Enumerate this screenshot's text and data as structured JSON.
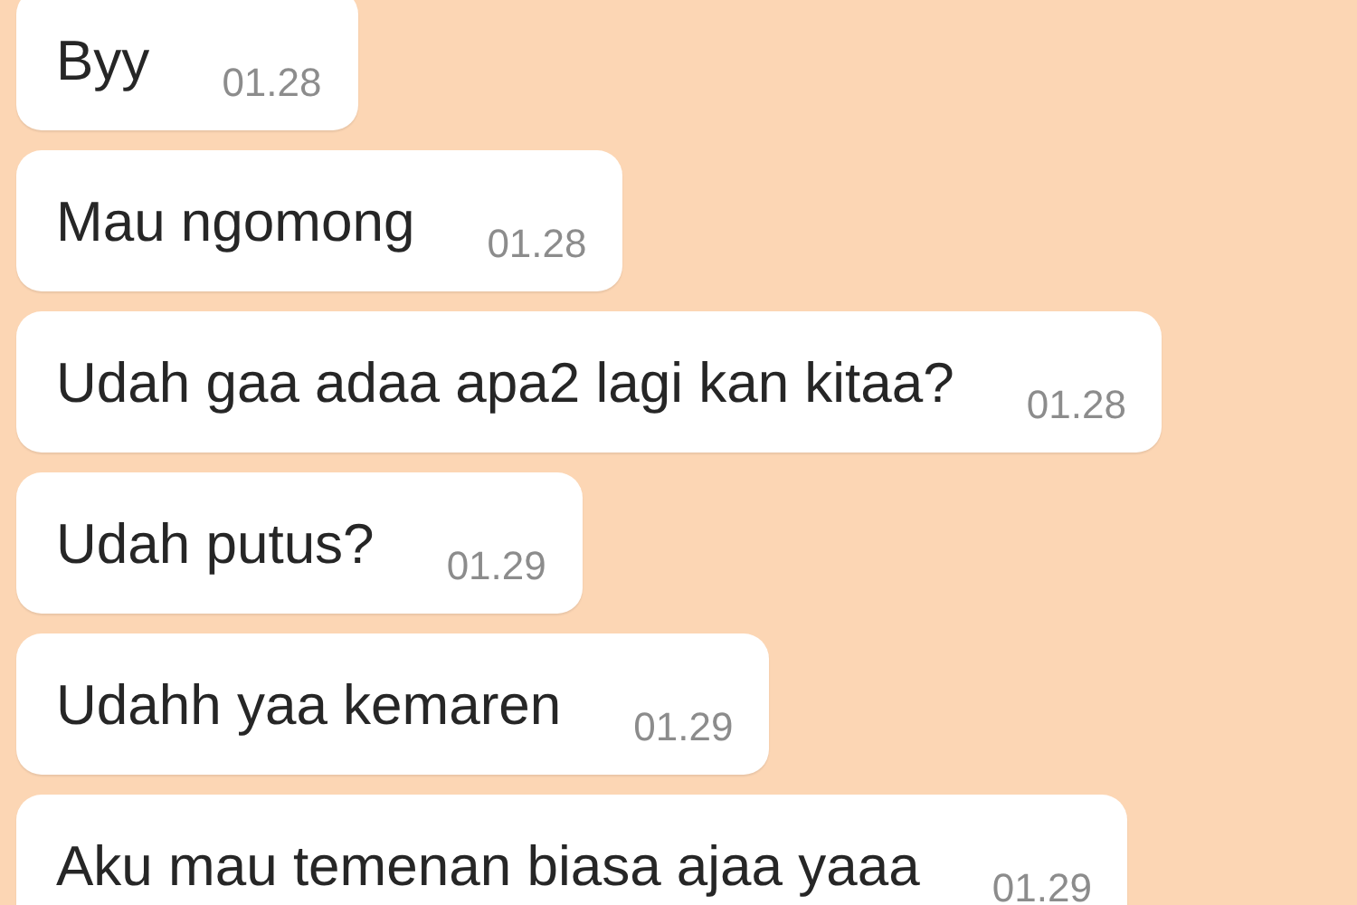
{
  "messages": [
    {
      "text": "Byy",
      "time": "01.28"
    },
    {
      "text": "Mau ngomong",
      "time": "01.28"
    },
    {
      "text": "Udah gaa adaa apa2 lagi kan kitaa?",
      "time": "01.28"
    },
    {
      "text": "Udah putus?",
      "time": "01.29"
    },
    {
      "text": "Udahh yaa kemaren",
      "time": "01.29"
    },
    {
      "text": "Aku mau temenan biasa ajaa yaaa",
      "time": "01.29"
    }
  ]
}
